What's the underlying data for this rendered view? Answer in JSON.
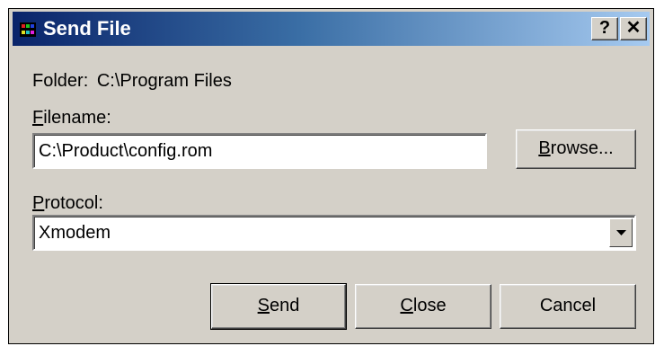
{
  "window": {
    "title": "Send File",
    "help_button": "?",
    "close_button": "✕"
  },
  "form": {
    "folder_label": "Folder:",
    "folder_value": "C:\\Program Files",
    "filename_label_key": "F",
    "filename_label_rest": "ilename:",
    "filename_value": "C:\\Product\\config.rom",
    "browse_key": "B",
    "browse_rest": "rowse...",
    "protocol_label_key": "P",
    "protocol_label_rest": "rotocol:",
    "protocol_value": "Xmodem"
  },
  "buttons": {
    "send_key": "S",
    "send_rest": "end",
    "close_key": "C",
    "close_rest": "lose",
    "cancel": "Cancel"
  },
  "colors": {
    "dialog_bg": "#d4d0c8",
    "title_start": "#0a246a",
    "title_end": "#a6caf0"
  }
}
